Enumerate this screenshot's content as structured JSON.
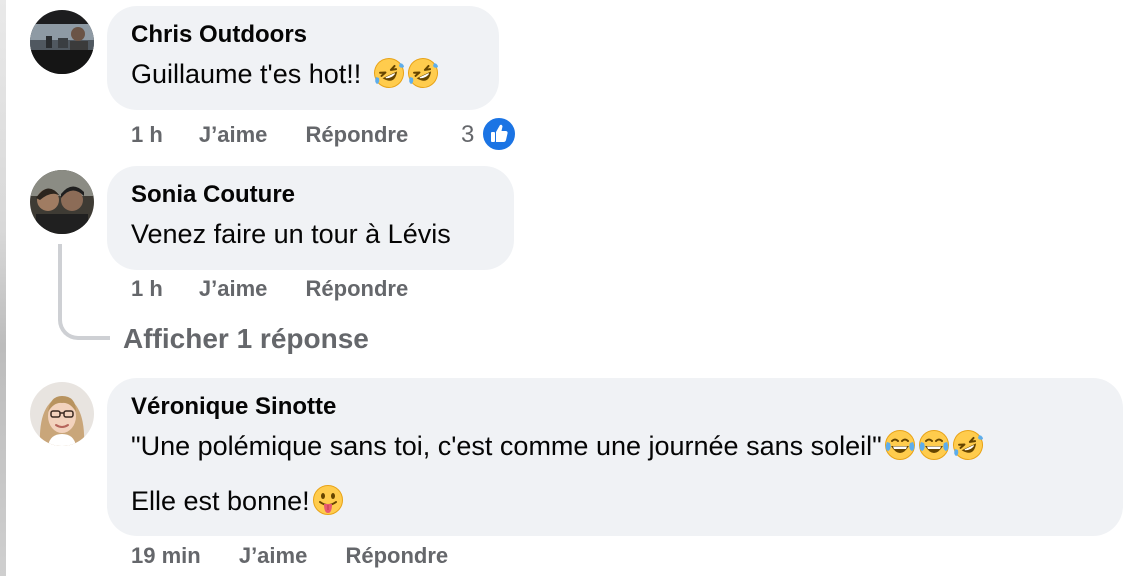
{
  "comments": [
    {
      "author": "Chris Outdoors",
      "text": "Guillaume t'es hot!!",
      "text_emojis": [
        "rolling-on-floor-laughing",
        "rolling-on-floor-laughing"
      ],
      "time": "1 h",
      "like_label": "J’aime",
      "reply_label": "Répondre",
      "reaction_count": "3",
      "reaction_type": "like"
    },
    {
      "author": "Sonia Couture",
      "text": "Venez faire un tour à Lévis",
      "time": "1 h",
      "like_label": "J’aime",
      "reply_label": "Répondre",
      "show_replies_label": "Afficher 1 réponse"
    },
    {
      "author": "Véronique Sinotte",
      "text_line1": "\"Une polémique sans toi, c'est comme une journée sans soleil\"",
      "text_line1_emojis": [
        "tears-of-joy",
        "tears-of-joy",
        "rolling-on-floor-laughing"
      ],
      "text_line2": "Elle est bonne!",
      "text_line2_emojis": [
        "tongue-out"
      ],
      "time": "19 min",
      "like_label": "J’aime",
      "reply_label": "Répondre"
    }
  ],
  "colors": {
    "bubble": "#f0f2f5",
    "text": "#050505",
    "secondary": "#65676b",
    "like_blue": "#1b74e4",
    "thread_line": "#ced0d4"
  }
}
